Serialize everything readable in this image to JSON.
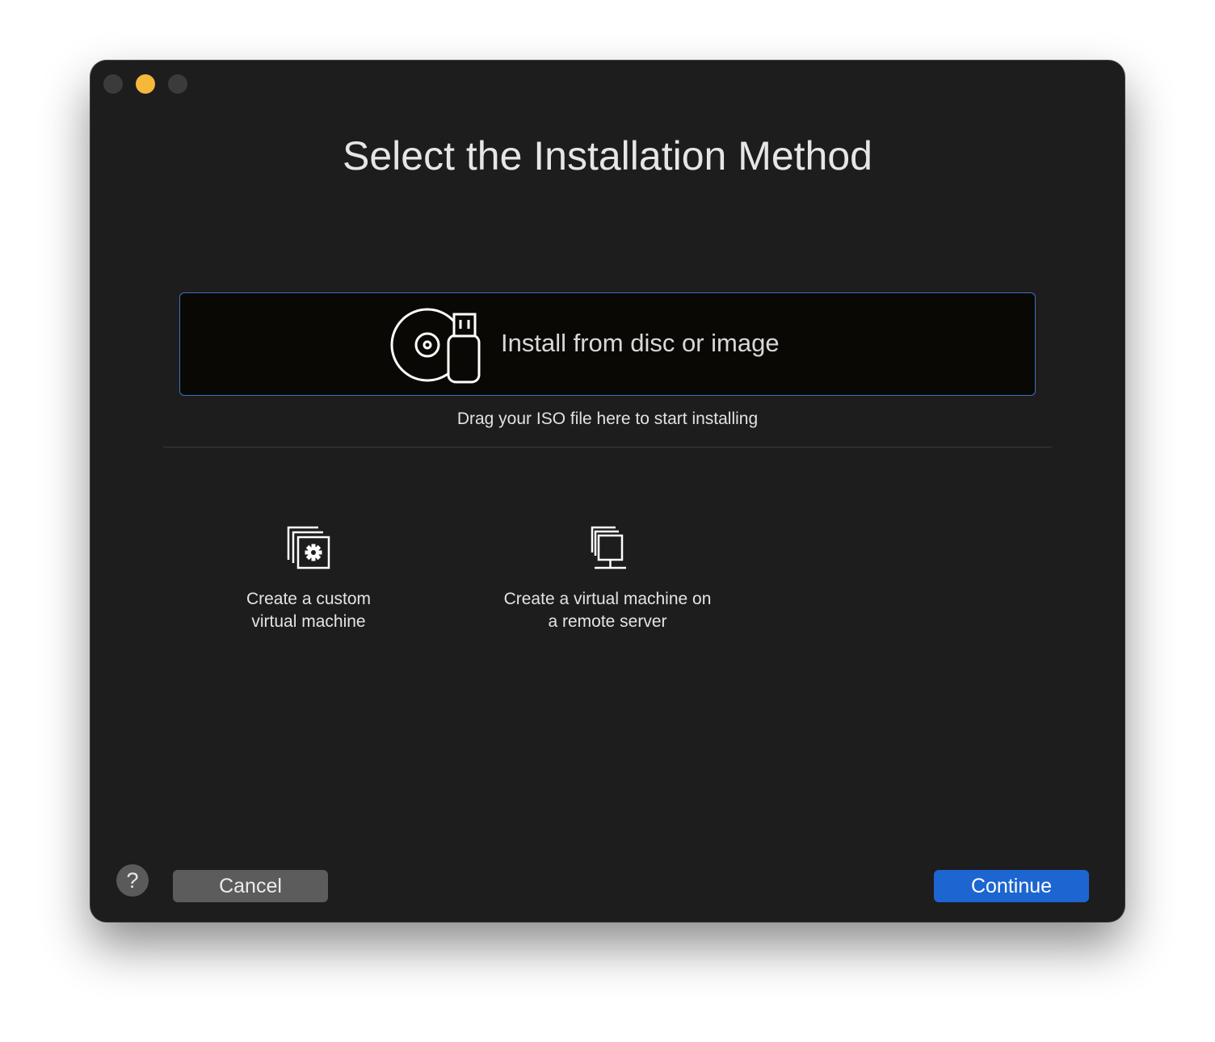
{
  "window": {
    "title": "Select the Installation Method"
  },
  "install_disc": {
    "label": "Install from disc or image",
    "icon": "disc-usb-icon",
    "hint": "Drag your ISO file here to start installing"
  },
  "options": [
    {
      "label": "Create a custom\nvirtual machine",
      "icon": "custom-vm-gear-icon"
    },
    {
      "label": "Create a virtual machine on\na remote server",
      "icon": "remote-server-icon"
    }
  ],
  "footer": {
    "help_label": "?",
    "cancel_label": "Cancel",
    "continue_label": "Continue"
  },
  "colors": {
    "window_bg": "#1d1d1d",
    "accent": "#1d65d0",
    "selection_border": "#3f6fc9",
    "minimize": "#f6b83b"
  }
}
